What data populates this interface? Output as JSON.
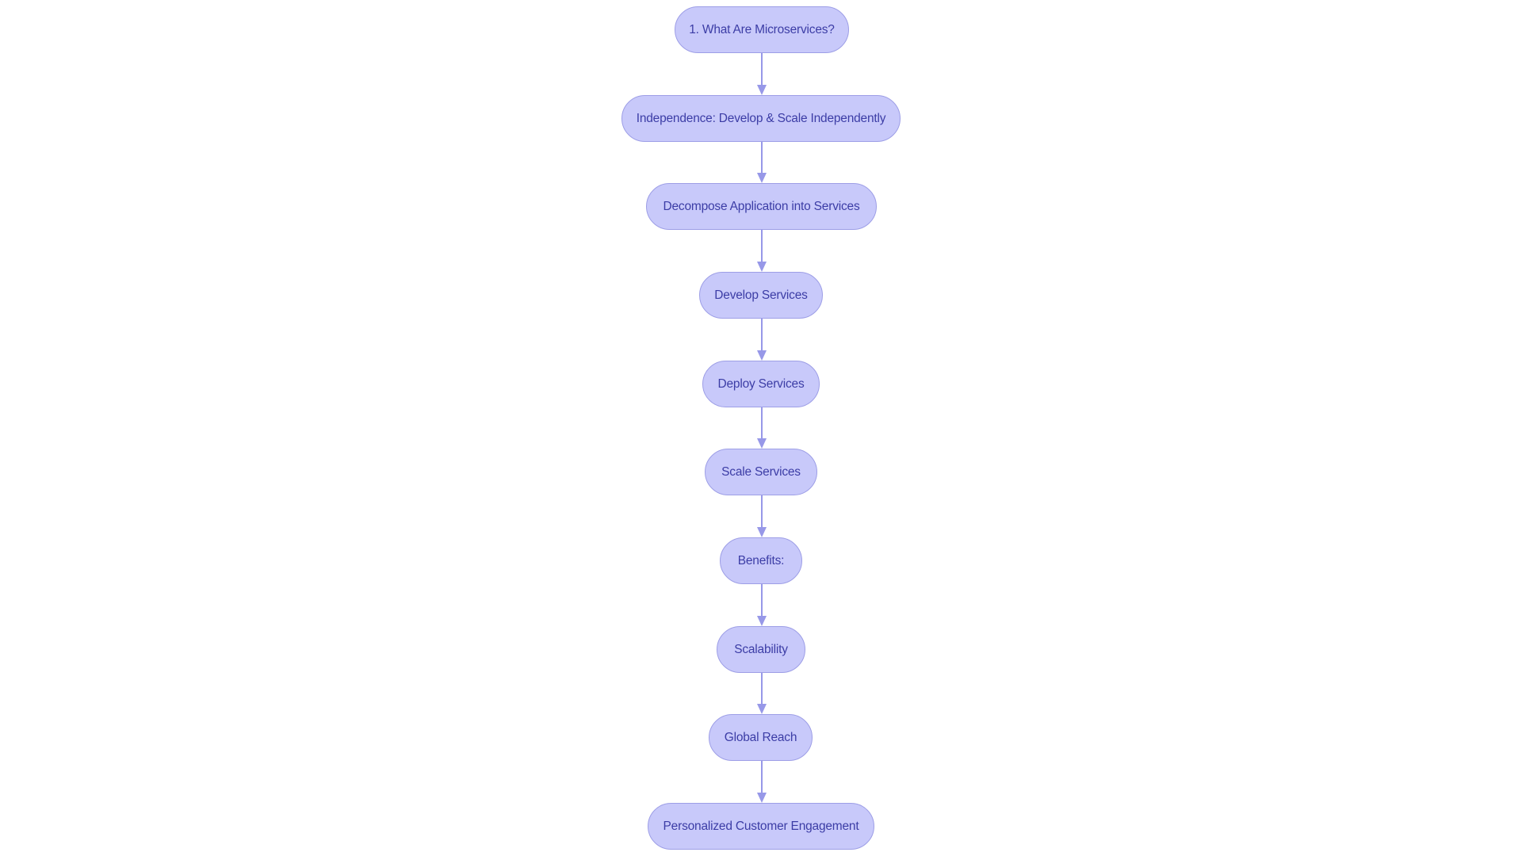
{
  "diagram": {
    "type": "flowchart",
    "direction": "top-to-bottom",
    "colors": {
      "node_fill": "#c8c9fa",
      "node_border": "#9d9ee6",
      "node_text": "#3c3da6",
      "edge": "#9798e8",
      "background": "#ffffff"
    },
    "nodes": [
      {
        "id": "n0",
        "label": "1. What Are Microservices?"
      },
      {
        "id": "n1",
        "label": "Independence: Develop & Scale Independently"
      },
      {
        "id": "n2",
        "label": "Decompose Application into Services"
      },
      {
        "id": "n3",
        "label": "Develop Services"
      },
      {
        "id": "n4",
        "label": "Deploy Services"
      },
      {
        "id": "n5",
        "label": "Scale Services"
      },
      {
        "id": "n6",
        "label": "Benefits:"
      },
      {
        "id": "n7",
        "label": "Scalability"
      },
      {
        "id": "n8",
        "label": "Global Reach"
      },
      {
        "id": "n9",
        "label": "Personalized Customer Engagement"
      }
    ],
    "edges": [
      {
        "from": "n0",
        "to": "n1"
      },
      {
        "from": "n1",
        "to": "n2"
      },
      {
        "from": "n2",
        "to": "n3"
      },
      {
        "from": "n3",
        "to": "n4"
      },
      {
        "from": "n4",
        "to": "n5"
      },
      {
        "from": "n5",
        "to": "n6"
      },
      {
        "from": "n6",
        "to": "n7"
      },
      {
        "from": "n7",
        "to": "n8"
      },
      {
        "from": "n8",
        "to": "n9"
      }
    ]
  }
}
